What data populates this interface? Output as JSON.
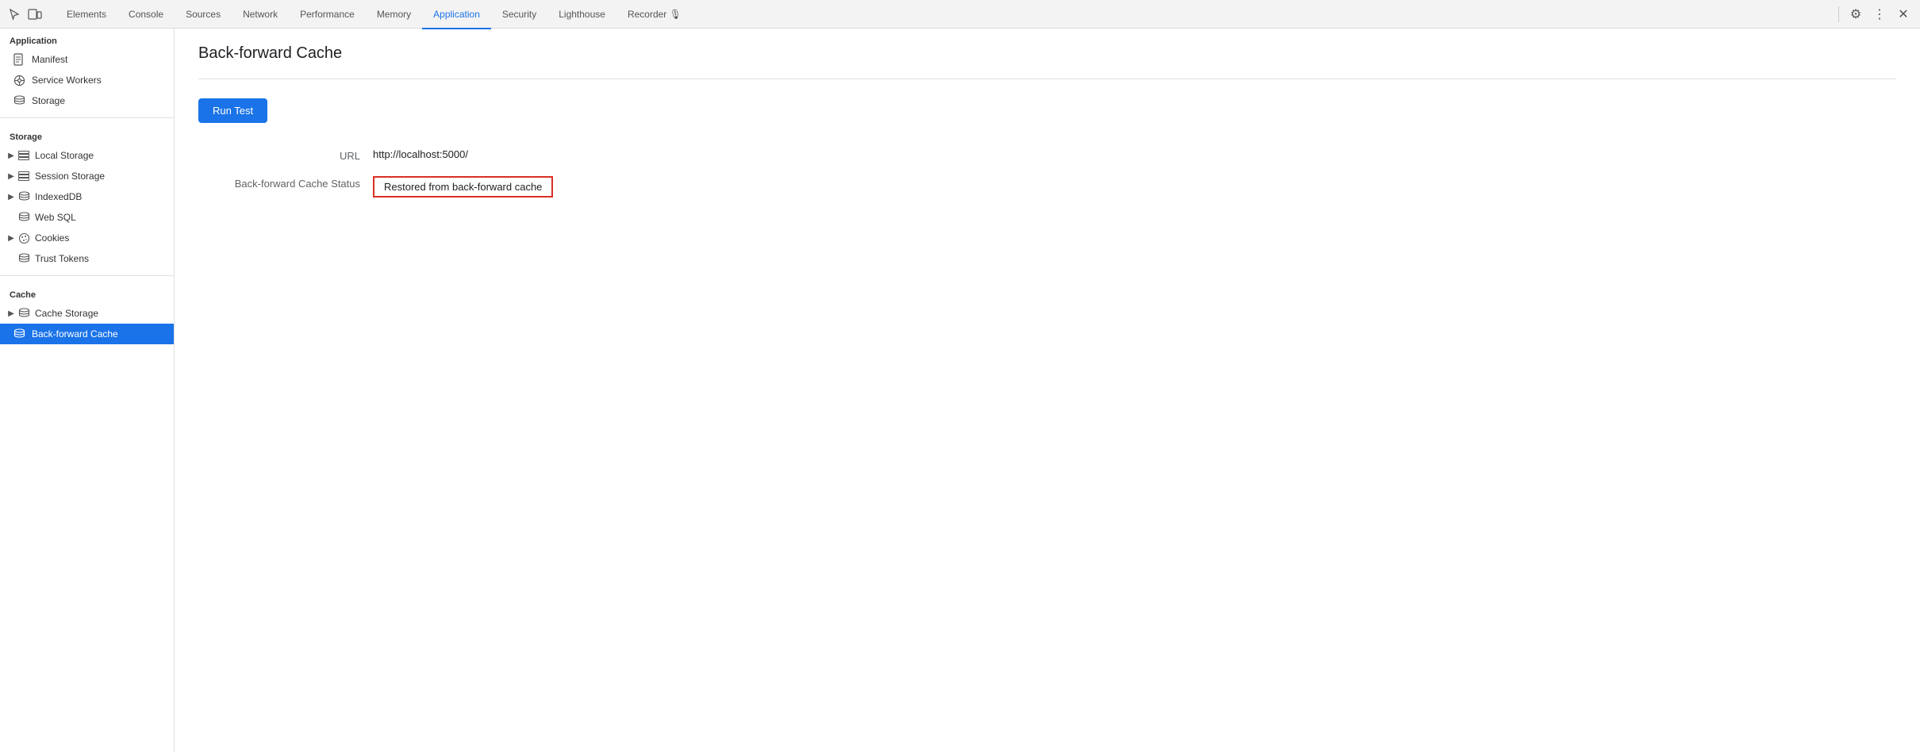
{
  "tabs": [
    {
      "id": "elements",
      "label": "Elements",
      "active": false
    },
    {
      "id": "console",
      "label": "Console",
      "active": false
    },
    {
      "id": "sources",
      "label": "Sources",
      "active": false
    },
    {
      "id": "network",
      "label": "Network",
      "active": false
    },
    {
      "id": "performance",
      "label": "Performance",
      "active": false
    },
    {
      "id": "memory",
      "label": "Memory",
      "active": false
    },
    {
      "id": "application",
      "label": "Application",
      "active": true
    },
    {
      "id": "security",
      "label": "Security",
      "active": false
    },
    {
      "id": "lighthouse",
      "label": "Lighthouse",
      "active": false
    },
    {
      "id": "recorder",
      "label": "Recorder 🎙",
      "active": false
    }
  ],
  "sidebar": {
    "application_section": "Application",
    "items_application": [
      {
        "id": "manifest",
        "label": "Manifest",
        "icon": "doc"
      },
      {
        "id": "service-workers",
        "label": "Service Workers",
        "icon": "gear"
      },
      {
        "id": "storage",
        "label": "Storage",
        "icon": "db"
      }
    ],
    "storage_section": "Storage",
    "items_storage": [
      {
        "id": "local-storage",
        "label": "Local Storage",
        "hasArrow": true,
        "icon": "grid"
      },
      {
        "id": "session-storage",
        "label": "Session Storage",
        "hasArrow": true,
        "icon": "grid"
      },
      {
        "id": "indexed-db",
        "label": "IndexedDB",
        "hasArrow": true,
        "icon": "db"
      },
      {
        "id": "web-sql",
        "label": "Web SQL",
        "hasArrow": false,
        "icon": "db"
      },
      {
        "id": "cookies",
        "label": "Cookies",
        "hasArrow": true,
        "icon": "cookie"
      },
      {
        "id": "trust-tokens",
        "label": "Trust Tokens",
        "hasArrow": false,
        "icon": "db"
      }
    ],
    "cache_section": "Cache",
    "items_cache": [
      {
        "id": "cache-storage",
        "label": "Cache Storage",
        "hasArrow": true,
        "icon": "db"
      },
      {
        "id": "back-forward-cache",
        "label": "Back-forward Cache",
        "hasArrow": false,
        "icon": "db",
        "active": true
      }
    ]
  },
  "content": {
    "page_title": "Back-forward Cache",
    "run_test_label": "Run Test",
    "url_label": "URL",
    "url_value": "http://localhost:5000/",
    "cache_status_label": "Back-forward Cache Status",
    "cache_status_value": "Restored from back-forward cache"
  }
}
